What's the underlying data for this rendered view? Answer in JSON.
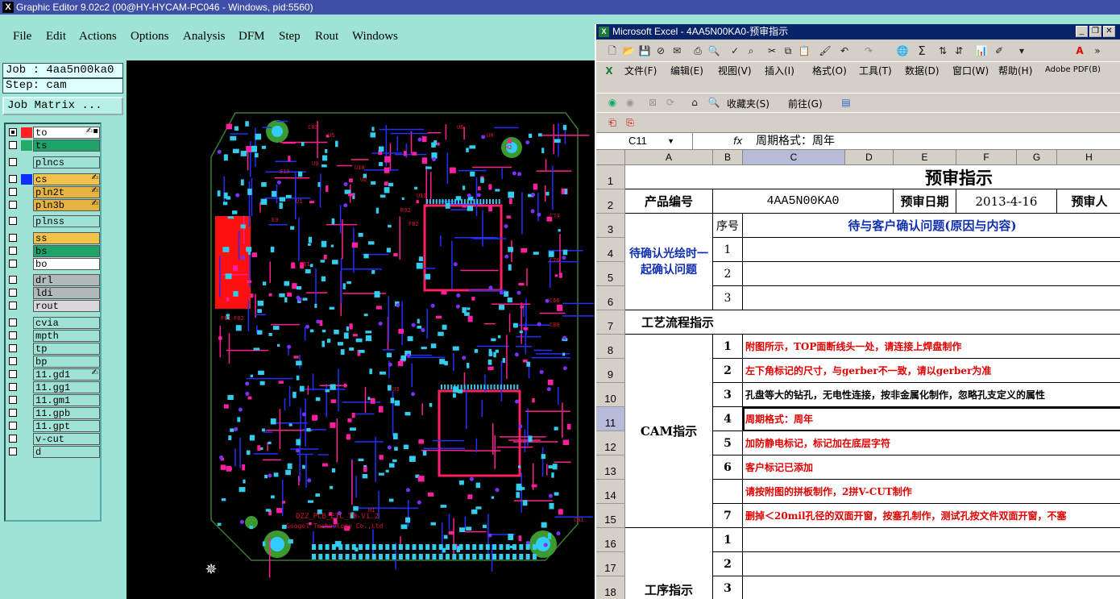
{
  "ge": {
    "title": "Graphic Editor 9.02c2 (00@HY-HYCAM-PC046 - Windows, pid:5560)",
    "menu": [
      "File",
      "Edit",
      "Actions",
      "Options",
      "Analysis",
      "DFM",
      "Step",
      "Rout",
      "Windows"
    ],
    "job": "Job : 4aa5n00ka0",
    "step": "Step: cam",
    "job_matrix": "Job Matrix ...",
    "layers": [
      {
        "name": "to",
        "checked": true,
        "color": "#ff2020",
        "bg": "#ffffff",
        "mark": "✍▪"
      },
      {
        "name": "ts",
        "checked": false,
        "color": "#22aa66",
        "bg": "#1fa36b",
        "mark": ""
      },
      {
        "name": "plncs",
        "checked": false,
        "color": "",
        "bg": "#9ee3d6",
        "mark": ""
      },
      {
        "name": "cs",
        "checked": false,
        "color": "#1030ff",
        "bg": "#f2c24a",
        "mark": "✍"
      },
      {
        "name": "pln2t",
        "checked": false,
        "color": "",
        "bg": "#e6b340",
        "mark": "✍"
      },
      {
        "name": "pln3b",
        "checked": false,
        "color": "",
        "bg": "#e6b340",
        "mark": "✍"
      },
      {
        "name": "plnss",
        "checked": false,
        "color": "",
        "bg": "#9ee3d6",
        "mark": ""
      },
      {
        "name": "ss",
        "checked": false,
        "color": "",
        "bg": "#f2c24a",
        "mark": ""
      },
      {
        "name": "bs",
        "checked": false,
        "color": "",
        "bg": "#1fa36b",
        "mark": ""
      },
      {
        "name": "bo",
        "checked": false,
        "color": "",
        "bg": "#ffffff",
        "mark": ""
      },
      {
        "name": "drl",
        "checked": false,
        "color": "",
        "bg": "#b0b8b8",
        "mark": ""
      },
      {
        "name": "ldi",
        "checked": false,
        "color": "",
        "bg": "#b0b8b8",
        "mark": ""
      },
      {
        "name": "rout",
        "checked": false,
        "color": "",
        "bg": "#d8d8d8",
        "mark": ""
      },
      {
        "name": "cvia",
        "checked": false,
        "color": "",
        "bg": "#9ee3d6",
        "mark": ""
      },
      {
        "name": "mpth",
        "checked": false,
        "color": "",
        "bg": "#9ee3d6",
        "mark": ""
      },
      {
        "name": "tp",
        "checked": false,
        "color": "",
        "bg": "#9ee3d6",
        "mark": ""
      },
      {
        "name": "bp",
        "checked": false,
        "color": "",
        "bg": "#9ee3d6",
        "mark": ""
      },
      {
        "name": "11.gd1",
        "checked": false,
        "color": "",
        "bg": "#9ee3d6",
        "mark": "✍"
      },
      {
        "name": "11.gg1",
        "checked": false,
        "color": "",
        "bg": "#9ee3d6",
        "mark": ""
      },
      {
        "name": "11.gm1",
        "checked": false,
        "color": "",
        "bg": "#9ee3d6",
        "mark": ""
      },
      {
        "name": "11.gpb",
        "checked": false,
        "color": "",
        "bg": "#9ee3d6",
        "mark": ""
      },
      {
        "name": "11.gpt",
        "checked": false,
        "color": "",
        "bg": "#9ee3d6",
        "mark": ""
      },
      {
        "name": "v-cut",
        "checked": false,
        "color": "",
        "bg": "#9ee3d6",
        "mark": ""
      },
      {
        "name": "d",
        "checked": false,
        "color": "",
        "bg": "#9ee3d6",
        "mark": ""
      }
    ],
    "pcb": {
      "silk_text_1": "DZZ_PCB_ETL_TH-V1.2",
      "silk_text_2": "Googol Technology Co.,Ltd",
      "labels": [
        "U1",
        "U2",
        "U3",
        "U5",
        "U6",
        "U8",
        "U9",
        "U10",
        "U11",
        "H1",
        "H2",
        "C83",
        "C74",
        "C76",
        "C66",
        "C80",
        "CN1",
        "E9",
        "E10",
        "R92",
        "F81",
        "F82",
        "FB1",
        "FB2"
      ]
    }
  },
  "excel": {
    "title": "Microsoft Excel - 4AA5N00KA0-预审指示",
    "menu": [
      "文件(F)",
      "编辑(E)",
      "视图(V)",
      "插入(I)",
      "格式(O)",
      "工具(T)",
      "数据(D)",
      "窗口(W)",
      "帮助(H)",
      "Adobe PDF(B)"
    ],
    "favorites": "收藏夹(S)",
    "goto": "前往(G)",
    "namebox": "C11",
    "fx": "fx",
    "formula": "周期格式：周年",
    "columns": [
      "A",
      "B",
      "C",
      "D",
      "E",
      "F",
      "G",
      "H"
    ],
    "rows": [
      "1",
      "2",
      "3",
      "4",
      "5",
      "6",
      "7",
      "8",
      "9",
      "10",
      "11",
      "12",
      "13",
      "14",
      "15",
      "16",
      "17",
      "18"
    ],
    "sheet": {
      "title": "预审指示",
      "product_no_label": "产品编号",
      "product_no": "4AA5N00KA0",
      "review_date_label": "预审日期",
      "review_date": "2013-4-16",
      "reviewer_label": "预审人",
      "confirm_label": "待确认光绘时一起确认问题",
      "seq_label": "序号",
      "confirm_header": "待与客户确认问题(原因与内容)",
      "confirm_nums": [
        "1",
        "2",
        "3"
      ],
      "process_label": "工艺流程指示",
      "cam_label": "CAM指示",
      "cam_items": [
        {
          "n": "1",
          "text": "附图所示，TOP面断线头一处，请连接上焊盘制作",
          "color": "red"
        },
        {
          "n": "2",
          "text": "左下角标记的尺寸，与gerber不一致，请以gerber为准",
          "color": "red"
        },
        {
          "n": "3",
          "text": "孔盘等大的钻孔，无电性连接，按非金属化制作，忽略孔支定义的属性",
          "color": "black"
        },
        {
          "n": "4",
          "text": "周期格式：周年",
          "color": "red"
        },
        {
          "n": "5",
          "text": "加防静电标记，标记加在底层字符",
          "color": "red"
        },
        {
          "n": "6",
          "text": "客户标记已添加",
          "color": "red"
        },
        {
          "n": "",
          "text": "请按附图的拼板制作，2拼V-CUT制作",
          "color": "red"
        },
        {
          "n": "7",
          "text": "删掉＜20mil孔径的双面开窗，按塞孔制作，测试孔按文件双面开窗，不塞",
          "color": "red"
        }
      ],
      "process2_label": "工序指示",
      "process2_nums": [
        "1",
        "2",
        "3"
      ]
    }
  }
}
